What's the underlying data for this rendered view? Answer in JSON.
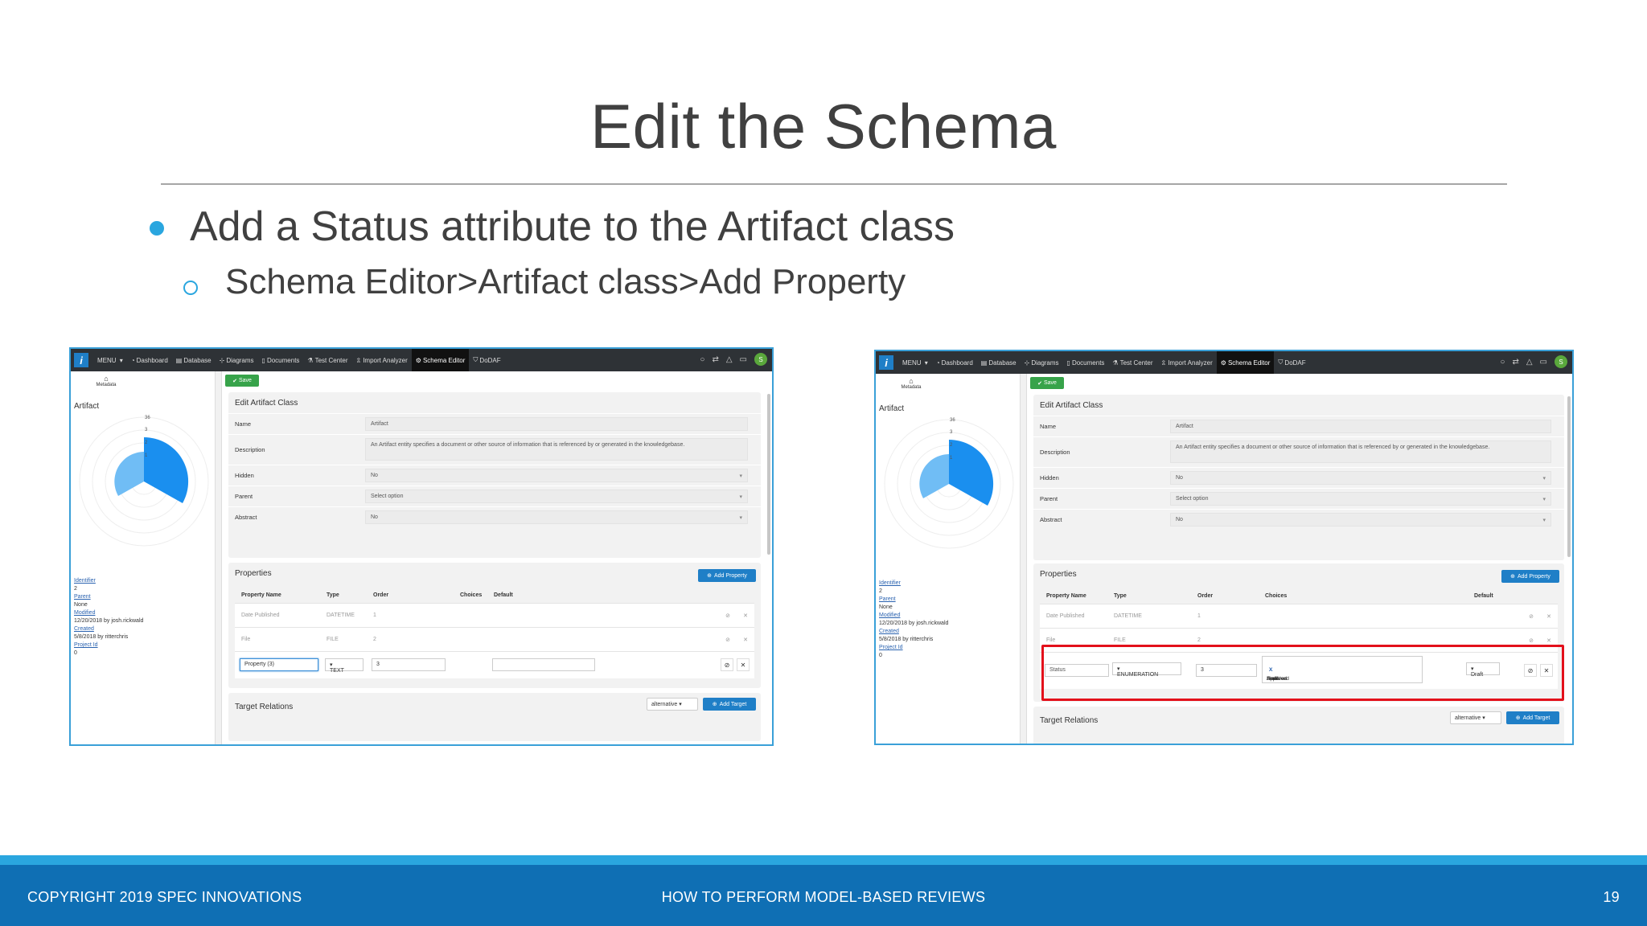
{
  "slide": {
    "title": "Edit the Schema",
    "bullet_1": "Add a Status attribute to the Artifact class",
    "bullet_2": "Schema Editor>Artifact class>Add Property",
    "footer_left": "COPYRIGHT 2019 SPEC INNOVATIONS",
    "footer_center": "HOW TO PERFORM MODEL-BASED REVIEWS",
    "page_number": "19"
  },
  "colors": {
    "accent": "#2aa6df",
    "footer_bar": "#0f6fb4",
    "highlight_box": "#e3101b",
    "primary_button": "#1f7fc7",
    "save_button": "#37a34a"
  },
  "app": {
    "nav": [
      "MENU",
      "Dashboard",
      "Database",
      "Diagrams",
      "Documents",
      "Test Center",
      "Import Analyzer",
      "Schema Editor",
      "DoDAF"
    ],
    "active_nav": "Schema Editor",
    "avatar_initial": "S",
    "metadata_tab": "Metadata",
    "save_label": "Save",
    "class_name": "Artifact",
    "panel_title": "Edit Artifact Class",
    "fields": {
      "name_label": "Name",
      "name_value": "Artifact",
      "description_label": "Description",
      "description_value": "An Artifact entity specifies a document or other source of information that is referenced by or generated in the knowledgebase.",
      "hidden_label": "Hidden",
      "hidden_value": "No",
      "parent_label": "Parent",
      "parent_placeholder": "Select option",
      "abstract_label": "Abstract",
      "abstract_value": "No"
    },
    "metadata": {
      "identifier_label": "Identifier",
      "identifier_value": "2",
      "parent_label": "Parent",
      "parent_value": "None",
      "modified_label": "Modified",
      "modified_value": "12/20/2018 by josh.rickwald",
      "created_label": "Created",
      "created_value": "5/8/2018 by ritterchris",
      "project_label": "Project Id",
      "project_value": "0"
    },
    "radar_ticks": [
      "36",
      "3",
      "2",
      "1"
    ],
    "properties_title": "Properties",
    "add_property_label": "Add Property",
    "columns": [
      "Property Name",
      "Type",
      "Order",
      "Choices",
      "Default"
    ],
    "rows": [
      {
        "name": "Date Published",
        "type": "DATETIME",
        "order": "1"
      },
      {
        "name": "File",
        "type": "FILE",
        "order": "2"
      }
    ],
    "new_row_left": {
      "name": "Property (3)",
      "type": "TEXT",
      "order": "3"
    },
    "new_row_right": {
      "name": "Status",
      "type": "ENUMERATION",
      "order": "3",
      "default": "Draft"
    },
    "choices": [
      "Draft",
      "Final",
      "Revision",
      "Approved",
      "Archived"
    ],
    "chip_remove": "X",
    "target_relations_title": "Target Relations",
    "target_select": "alternative",
    "add_target_label": "Add Target"
  }
}
